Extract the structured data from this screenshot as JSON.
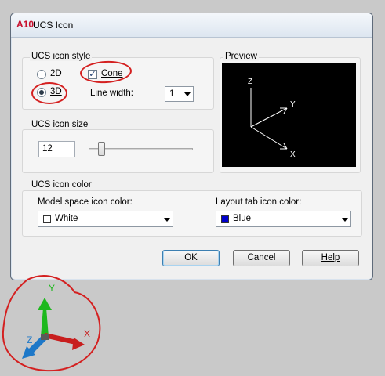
{
  "dialog": {
    "title": "UCS Icon",
    "app_icon_text": "A10"
  },
  "style_group": {
    "title": "UCS icon style",
    "option_2d": "2D",
    "option_3d": "3D",
    "selected": "3D",
    "cone_label": "Cone",
    "cone_checked": true,
    "line_width_label": "Line width:",
    "line_width_value": "1"
  },
  "preview_group": {
    "title": "Preview",
    "axis_z": "Z",
    "axis_y": "Y",
    "axis_x": "X"
  },
  "size_group": {
    "title": "UCS icon size",
    "value": "12",
    "slider_fraction": 0.1
  },
  "color_group": {
    "title": "UCS icon color",
    "model_label": "Model space icon color:",
    "model_value": "White",
    "model_swatch": "#ffffff",
    "layout_label": "Layout tab icon color:",
    "layout_value": "Blue",
    "layout_swatch": "#0000cc"
  },
  "buttons": {
    "ok": "OK",
    "cancel": "Cancel",
    "help": "Help"
  },
  "background_icon": {
    "axis_y": "Y",
    "axis_x": "X",
    "axis_z": "Z",
    "colors": {
      "y": "#1db81d",
      "x": "#c81e1e",
      "z": "#1e78c8"
    }
  },
  "annotation_color": "#d42020"
}
